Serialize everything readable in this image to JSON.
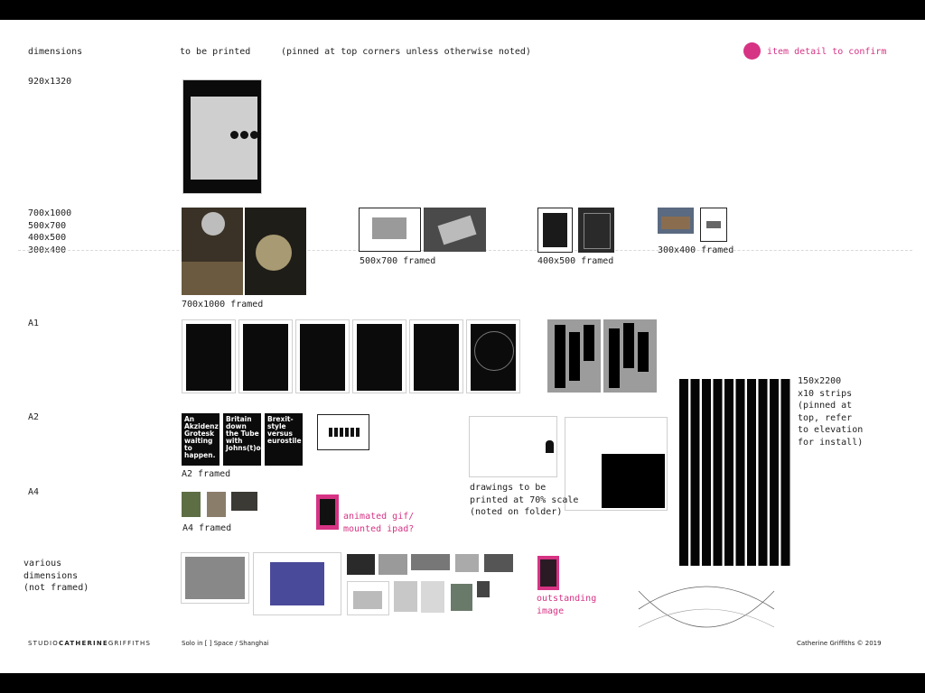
{
  "header": {
    "dimensions": "dimensions",
    "to_be_printed": "to be printed",
    "pinned_note": "(pinned at top corners unless otherwise noted)",
    "legend_label": "item detail to confirm",
    "legend_color": "#d63384"
  },
  "rows": {
    "r920": "920x1320",
    "r700": "700x1000",
    "r500": "500x700",
    "r400": "400x500",
    "r300": "300x400",
    "a1": "A1",
    "a2": "A2",
    "a4": "A4",
    "various": "various\ndimensions\n(not framed)"
  },
  "captions": {
    "c700": "700x1000 framed",
    "c500": "500x700 framed",
    "c400": "400x500 framed",
    "c300": "300x400 framed",
    "a2_framed": "A2 framed",
    "a4_framed": "A4 framed",
    "animated": "animated gif/\nmounted ipad?",
    "drawings": "drawings to be\nprinted at 70% scale\n(noted on folder)",
    "strips": "150x2200\nx10 strips\n(pinned at\ntop, refer\nto elevation\nfor install)",
    "outstanding": "outstanding\nimage"
  },
  "posters": {
    "p1": "An\nAkzidenz\nGrotesk\nwaiting to\nhappen.",
    "p2": "Britain\ndown\nthe Tube\nwith\nJohns(t)on",
    "p3": "Brexit-\nstyle\nversus\neurostile"
  },
  "footer": {
    "studio_prefix": "STUDIO",
    "studio_name": "CATHERINE",
    "studio_suffix": "GRIFFITHS",
    "project": "Solo in [   ] Space / Shanghai",
    "copyright": "Catherine Griffiths © 2019"
  }
}
